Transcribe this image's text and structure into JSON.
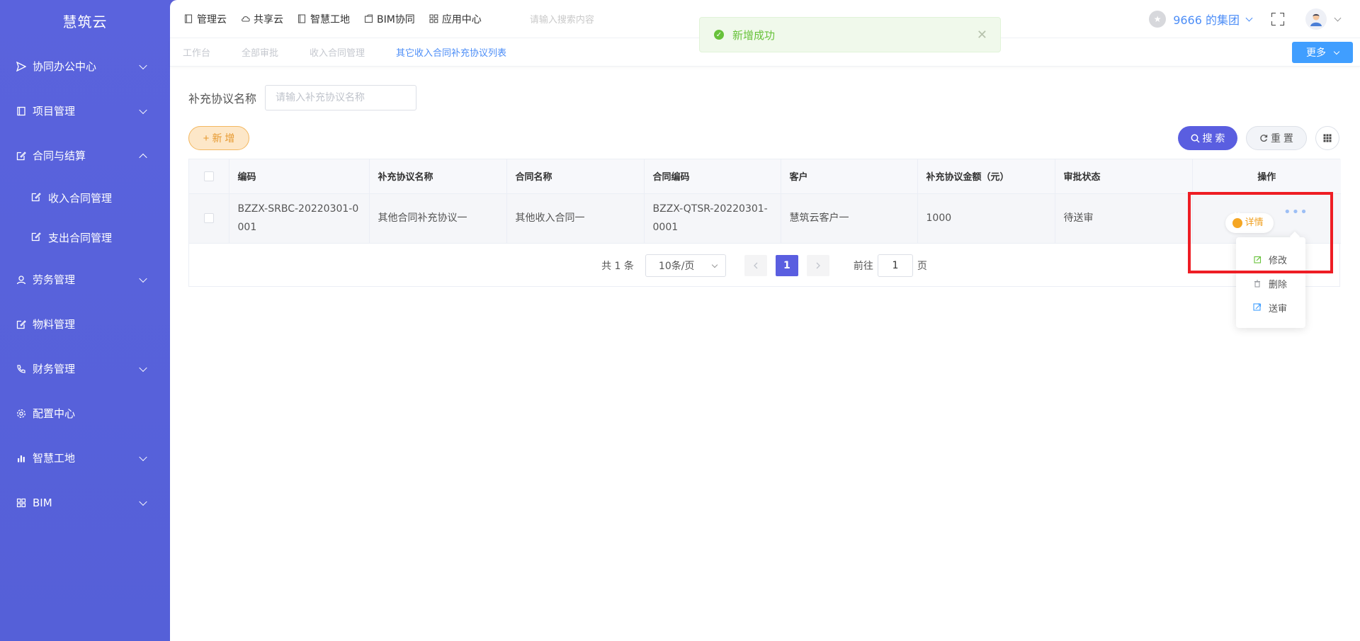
{
  "sidebar": {
    "brand": "慧筑云",
    "items": [
      {
        "label": "协同办公中心",
        "icon": "send-icon",
        "expandable": true
      },
      {
        "label": "项目管理",
        "icon": "book-icon",
        "expandable": true
      },
      {
        "label": "合同与结算",
        "icon": "edit-doc-icon",
        "expandable": true,
        "expanded": true,
        "children": [
          {
            "label": "收入合同管理",
            "icon": "edit-doc-icon"
          },
          {
            "label": "支出合同管理",
            "icon": "edit-doc-icon"
          }
        ]
      },
      {
        "label": "劳务管理",
        "icon": "user-badge-icon",
        "expandable": true
      },
      {
        "label": "物料管理",
        "icon": "edit-doc-icon",
        "expandable": false
      },
      {
        "label": "财务管理",
        "icon": "phone-icon",
        "expandable": true
      },
      {
        "label": "配置中心",
        "icon": "gear-icon",
        "expandable": false
      },
      {
        "label": "智慧工地",
        "icon": "bar-chart-icon",
        "expandable": true
      },
      {
        "label": "BIM",
        "icon": "grid-icon",
        "expandable": true
      }
    ]
  },
  "topnav": {
    "items": [
      {
        "label": "管理云",
        "icon": "doc-icon"
      },
      {
        "label": "共享云",
        "icon": "cloud-icon"
      },
      {
        "label": "智慧工地",
        "icon": "doc-icon"
      },
      {
        "label": "BIM协同",
        "icon": "box-icon"
      },
      {
        "label": "应用中心",
        "icon": "apps-icon"
      }
    ],
    "search_ghost": "请输入搜索内容",
    "org": "9666 的集团"
  },
  "tabs": {
    "items": [
      "工作台",
      "全部审批",
      "收入合同管理",
      "其它收入合同补充协议列表"
    ],
    "active_index": 3,
    "more_label": "更多"
  },
  "toast": {
    "message": "新增成功",
    "color": "#67c23a"
  },
  "filter": {
    "label": "补充协议名称",
    "placeholder": "请输入补充协议名称",
    "value": ""
  },
  "buttons": {
    "add": "新 增",
    "search": "搜 索",
    "reset": "重 置"
  },
  "table": {
    "columns": [
      "编码",
      "补充协议名称",
      "合同名称",
      "合同编码",
      "客户",
      "补充协议金额（元）",
      "审批状态",
      "操作"
    ],
    "rows": [
      {
        "code": "BZZX-SRBC-20220301-0001",
        "agreement_name": "其他合同补充协议一",
        "contract_name": "其他收入合同一",
        "contract_code": "BZZX-QTSR-20220301-0001",
        "customer": "慧筑云客户一",
        "amount": "1000",
        "status": "待送审",
        "action": "详情"
      }
    ]
  },
  "pager": {
    "total": "共 1 条",
    "page_size": "10条/页",
    "current_page": "1",
    "goto_prefix": "前往",
    "goto_value": "1",
    "goto_suffix": "页"
  },
  "dropdown": {
    "items": [
      {
        "label": "修改",
        "icon": "edit-icon"
      },
      {
        "label": "删除",
        "icon": "trash-icon"
      },
      {
        "label": "送审",
        "icon": "submit-icon"
      }
    ]
  },
  "colors": {
    "sidebar": "#5a63dd",
    "primary": "#5a5ee0",
    "link": "#4d8ef7",
    "highlight": "#ee1d24"
  }
}
